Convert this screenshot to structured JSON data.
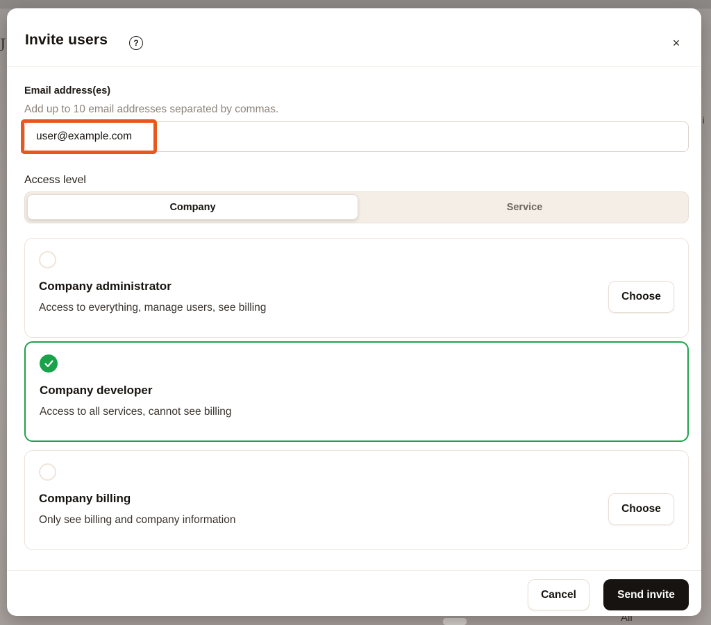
{
  "modal": {
    "title": "Invite users",
    "email": {
      "label": "Email address(es)",
      "helper": "Add up to 10 email addresses separated by commas.",
      "value": "user@example.com"
    },
    "access_level": {
      "label": "Access level",
      "tabs": [
        {
          "label": "Company",
          "selected": true
        },
        {
          "label": "Service",
          "selected": false
        }
      ],
      "options": [
        {
          "title": "Company administrator",
          "description": "Access to everything, manage users, see billing",
          "selected": false,
          "action_label": "Choose"
        },
        {
          "title": "Company developer",
          "description": "Access to all services, cannot see billing",
          "selected": true
        },
        {
          "title": "Company billing",
          "description": "Only see billing and company information",
          "selected": false,
          "action_label": "Choose"
        }
      ]
    },
    "footer": {
      "cancel_label": "Cancel",
      "submit_label": "Send invite"
    },
    "icons": {
      "help": "?",
      "close": "×"
    }
  },
  "annotation": {
    "color": "#ea571c"
  },
  "colors": {
    "selected_green": "#1ca24a",
    "primary_button": "#171310",
    "segmented_bg": "#f4eee7"
  },
  "backdrop": {
    "fragment_left": "J",
    "fragment_right": "i",
    "fragment_bottom": "All"
  }
}
